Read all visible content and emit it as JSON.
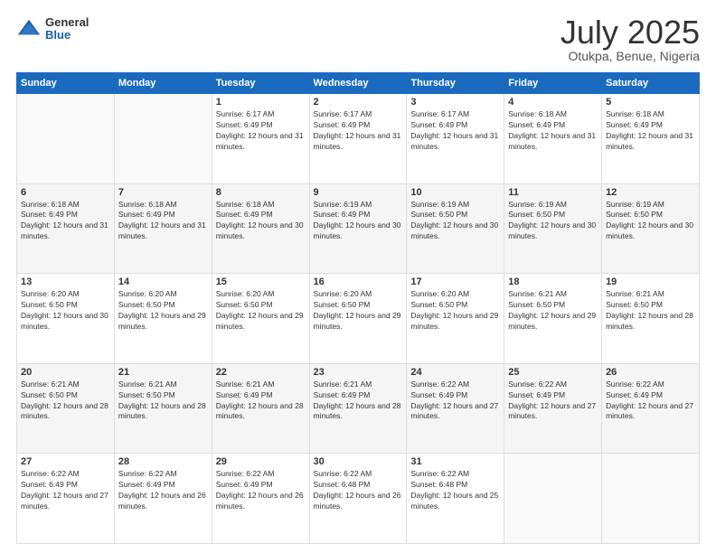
{
  "header": {
    "logo": {
      "general": "General",
      "blue": "Blue"
    },
    "title": "July 2025",
    "location": "Otukpa, Benue, Nigeria"
  },
  "calendar": {
    "days_of_week": [
      "Sunday",
      "Monday",
      "Tuesday",
      "Wednesday",
      "Thursday",
      "Friday",
      "Saturday"
    ],
    "weeks": [
      [
        {
          "day": "",
          "info": ""
        },
        {
          "day": "",
          "info": ""
        },
        {
          "day": "1",
          "info": "Sunrise: 6:17 AM\nSunset: 6:49 PM\nDaylight: 12 hours and 31 minutes."
        },
        {
          "day": "2",
          "info": "Sunrise: 6:17 AM\nSunset: 6:49 PM\nDaylight: 12 hours and 31 minutes."
        },
        {
          "day": "3",
          "info": "Sunrise: 6:17 AM\nSunset: 6:49 PM\nDaylight: 12 hours and 31 minutes."
        },
        {
          "day": "4",
          "info": "Sunrise: 6:18 AM\nSunset: 6:49 PM\nDaylight: 12 hours and 31 minutes."
        },
        {
          "day": "5",
          "info": "Sunrise: 6:18 AM\nSunset: 6:49 PM\nDaylight: 12 hours and 31 minutes."
        }
      ],
      [
        {
          "day": "6",
          "info": "Sunrise: 6:18 AM\nSunset: 6:49 PM\nDaylight: 12 hours and 31 minutes."
        },
        {
          "day": "7",
          "info": "Sunrise: 6:18 AM\nSunset: 6:49 PM\nDaylight: 12 hours and 31 minutes."
        },
        {
          "day": "8",
          "info": "Sunrise: 6:18 AM\nSunset: 6:49 PM\nDaylight: 12 hours and 30 minutes."
        },
        {
          "day": "9",
          "info": "Sunrise: 6:19 AM\nSunset: 6:49 PM\nDaylight: 12 hours and 30 minutes."
        },
        {
          "day": "10",
          "info": "Sunrise: 6:19 AM\nSunset: 6:50 PM\nDaylight: 12 hours and 30 minutes."
        },
        {
          "day": "11",
          "info": "Sunrise: 6:19 AM\nSunset: 6:50 PM\nDaylight: 12 hours and 30 minutes."
        },
        {
          "day": "12",
          "info": "Sunrise: 6:19 AM\nSunset: 6:50 PM\nDaylight: 12 hours and 30 minutes."
        }
      ],
      [
        {
          "day": "13",
          "info": "Sunrise: 6:20 AM\nSunset: 6:50 PM\nDaylight: 12 hours and 30 minutes."
        },
        {
          "day": "14",
          "info": "Sunrise: 6:20 AM\nSunset: 6:50 PM\nDaylight: 12 hours and 29 minutes."
        },
        {
          "day": "15",
          "info": "Sunrise: 6:20 AM\nSunset: 6:50 PM\nDaylight: 12 hours and 29 minutes."
        },
        {
          "day": "16",
          "info": "Sunrise: 6:20 AM\nSunset: 6:50 PM\nDaylight: 12 hours and 29 minutes."
        },
        {
          "day": "17",
          "info": "Sunrise: 6:20 AM\nSunset: 6:50 PM\nDaylight: 12 hours and 29 minutes."
        },
        {
          "day": "18",
          "info": "Sunrise: 6:21 AM\nSunset: 6:50 PM\nDaylight: 12 hours and 29 minutes."
        },
        {
          "day": "19",
          "info": "Sunrise: 6:21 AM\nSunset: 6:50 PM\nDaylight: 12 hours and 28 minutes."
        }
      ],
      [
        {
          "day": "20",
          "info": "Sunrise: 6:21 AM\nSunset: 6:50 PM\nDaylight: 12 hours and 28 minutes."
        },
        {
          "day": "21",
          "info": "Sunrise: 6:21 AM\nSunset: 6:50 PM\nDaylight: 12 hours and 28 minutes."
        },
        {
          "day": "22",
          "info": "Sunrise: 6:21 AM\nSunset: 6:49 PM\nDaylight: 12 hours and 28 minutes."
        },
        {
          "day": "23",
          "info": "Sunrise: 6:21 AM\nSunset: 6:49 PM\nDaylight: 12 hours and 28 minutes."
        },
        {
          "day": "24",
          "info": "Sunrise: 6:22 AM\nSunset: 6:49 PM\nDaylight: 12 hours and 27 minutes."
        },
        {
          "day": "25",
          "info": "Sunrise: 6:22 AM\nSunset: 6:49 PM\nDaylight: 12 hours and 27 minutes."
        },
        {
          "day": "26",
          "info": "Sunrise: 6:22 AM\nSunset: 6:49 PM\nDaylight: 12 hours and 27 minutes."
        }
      ],
      [
        {
          "day": "27",
          "info": "Sunrise: 6:22 AM\nSunset: 6:49 PM\nDaylight: 12 hours and 27 minutes."
        },
        {
          "day": "28",
          "info": "Sunrise: 6:22 AM\nSunset: 6:49 PM\nDaylight: 12 hours and 26 minutes."
        },
        {
          "day": "29",
          "info": "Sunrise: 6:22 AM\nSunset: 6:49 PM\nDaylight: 12 hours and 26 minutes."
        },
        {
          "day": "30",
          "info": "Sunrise: 6:22 AM\nSunset: 6:48 PM\nDaylight: 12 hours and 26 minutes."
        },
        {
          "day": "31",
          "info": "Sunrise: 6:22 AM\nSunset: 6:48 PM\nDaylight: 12 hours and 25 minutes."
        },
        {
          "day": "",
          "info": ""
        },
        {
          "day": "",
          "info": ""
        }
      ]
    ]
  }
}
